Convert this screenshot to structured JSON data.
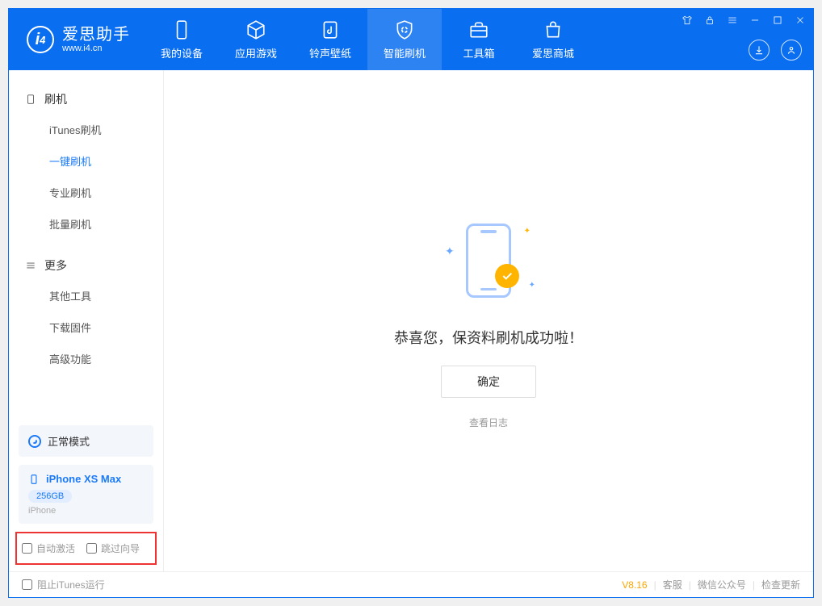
{
  "app": {
    "name": "爱思助手",
    "url": "www.i4.cn"
  },
  "nav": {
    "items": [
      {
        "label": "我的设备"
      },
      {
        "label": "应用游戏"
      },
      {
        "label": "铃声壁纸"
      },
      {
        "label": "智能刷机"
      },
      {
        "label": "工具箱"
      },
      {
        "label": "爱思商城"
      }
    ],
    "active_index": 3
  },
  "sidebar": {
    "group1": {
      "title": "刷机",
      "items": [
        "iTunes刷机",
        "一键刷机",
        "专业刷机",
        "批量刷机"
      ],
      "active_index": 1
    },
    "group2": {
      "title": "更多",
      "items": [
        "其他工具",
        "下载固件",
        "高级功能"
      ]
    }
  },
  "mode": {
    "label": "正常模式"
  },
  "device": {
    "name": "iPhone XS Max",
    "capacity": "256GB",
    "type": "iPhone"
  },
  "options": {
    "auto_activate": "自动激活",
    "skip_wizard": "跳过向导"
  },
  "main": {
    "success_text": "恭喜您，保资料刷机成功啦！",
    "ok_button": "确定",
    "view_log": "查看日志"
  },
  "status": {
    "block_itunes": "阻止iTunes运行",
    "version": "V8.16",
    "links": [
      "客服",
      "微信公众号",
      "检查更新"
    ]
  }
}
